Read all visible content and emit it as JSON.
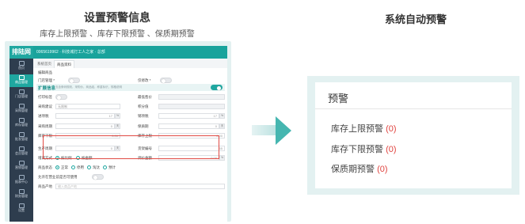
{
  "left": {
    "title": "设置预警信息",
    "subtitle": "库存上限预警 、库存下限预警 、保质期预警"
  },
  "right": {
    "title": "系统自动预警"
  },
  "app": {
    "logo": "排陆网",
    "top_breadcrumb": "0065619962 · 科技城打工人之家 · 总部",
    "sidebar": [
      {
        "label": "首页",
        "icon": "home-icon"
      },
      {
        "label": "商品管理",
        "icon": "goods-icon"
      },
      {
        "label": "门店管理",
        "icon": "store-icon"
      },
      {
        "label": "采购管理",
        "icon": "purchase-icon"
      },
      {
        "label": "库存管理",
        "icon": "stock-icon"
      },
      {
        "label": "批发管理",
        "icon": "wholesale-icon"
      },
      {
        "label": "会员管理",
        "icon": "member-icon"
      },
      {
        "label": "营销管理",
        "icon": "marketing-icon"
      },
      {
        "label": "报表中心",
        "icon": "report-icon"
      },
      {
        "label": "财务管理",
        "icon": "finance-icon"
      },
      {
        "label": "设置",
        "icon": "settings-icon"
      }
    ],
    "tabs": [
      "系统首页",
      "商品资料"
    ],
    "form": {
      "heading": "编辑商品",
      "store_label": "门店管理 *",
      "trace_label": "仅修改 *",
      "section_title": "扩展信息",
      "section_hint": "包含条码规则，采购价，商品组，称重标识，规格说明",
      "print_label": "打印标签",
      "min_qty_label": "最低售价",
      "purchase_type_label": "采购建议",
      "purchase_type_value": "无限制",
      "quantity_label": "积分值",
      "origin_label": "进项税",
      "origin_value": "17",
      "output_label": "销项税",
      "output_value": "17",
      "shelf_life_label": "采购周期",
      "shelf_value": "0",
      "unit_day": "天",
      "safety_label": "保质期",
      "safety_value": "0",
      "min_stock_label": "库存下限",
      "min_stock_value": "0.00",
      "max_stock_label": "库存上限",
      "max_stock_value": "0.00",
      "prod_date_label": "生产周期",
      "prod_value": "0",
      "unit_no_label": "货架编号",
      "unit_no_value": "55",
      "deliver_label": "增减方式",
      "deliver_opt1": "按比例",
      "deliver_opt2": "按金额",
      "deliver_amt_label": "调价金额",
      "deliver_amt_value": "0.00",
      "status_label": "商品状态",
      "status_opts": [
        "正常",
        "停用",
        "淘汰",
        "预计"
      ],
      "allow_label": "允许在营业前是否可使用",
      "origin_place_label": "商品产地",
      "origin_place_placeholder": "输入商品产地"
    }
  },
  "warnings": {
    "title": "预警",
    "items": [
      {
        "label": "库存上限预警",
        "count": "0"
      },
      {
        "label": "库存下限预警",
        "count": "0"
      },
      {
        "label": "保质期预警",
        "count": "0"
      }
    ]
  }
}
